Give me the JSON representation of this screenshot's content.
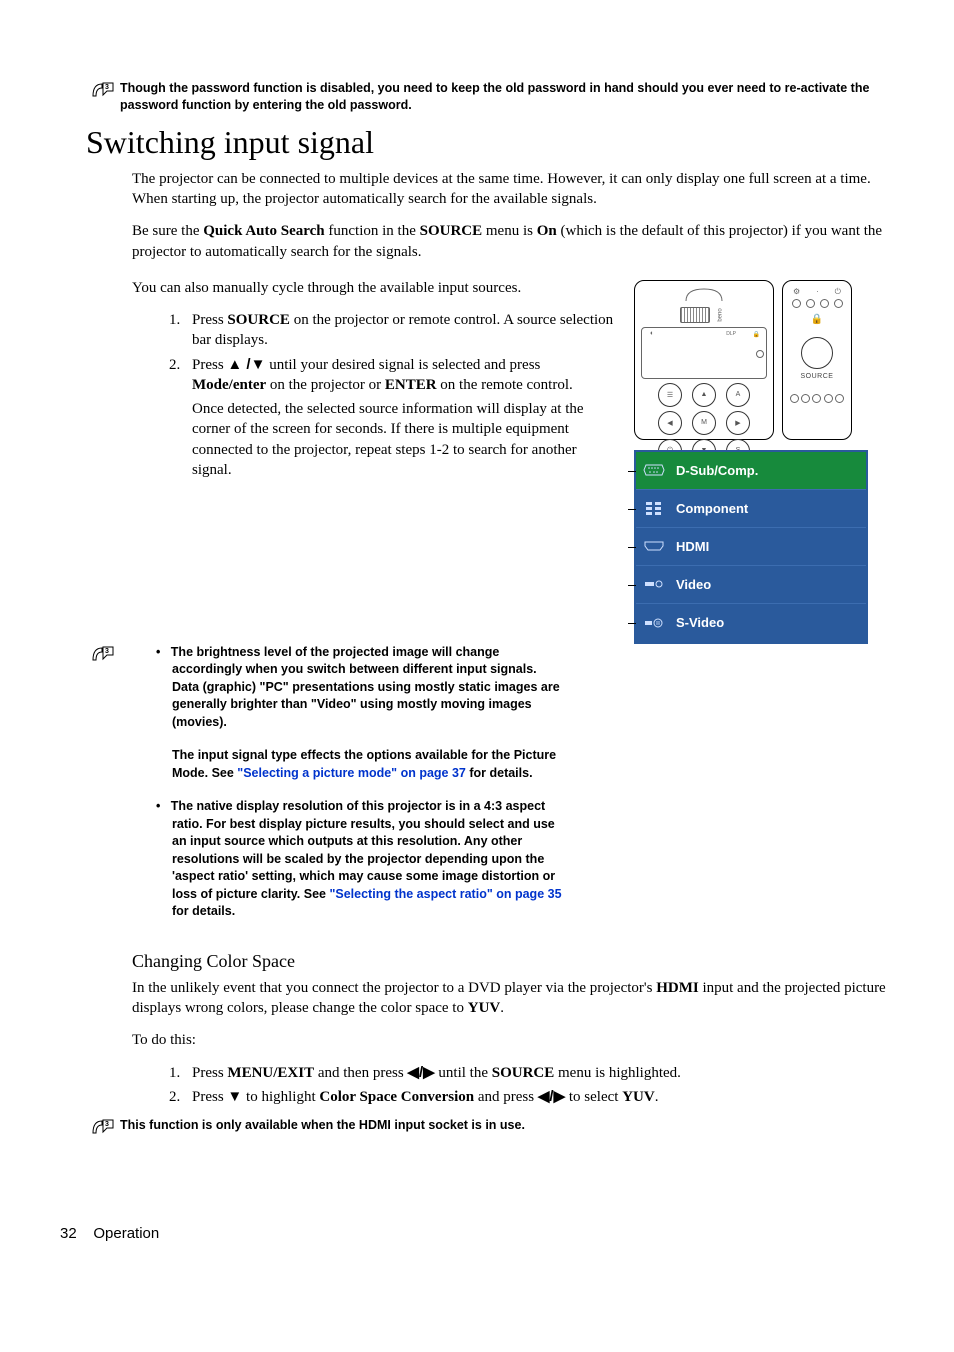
{
  "top_note": "Though the password function is disabled, you need to keep the old password in hand should you ever need to re-activate the password function by entering the old password.",
  "heading": "Switching input signal",
  "para1": "The projector can be connected to multiple devices at the same time. However, it can only display one full screen at a time. When starting up, the projector automatically search for the available signals.",
  "para2_pre": "Be sure the ",
  "para2_qas": "Quick Auto Search",
  "para2_mid1": " function in the ",
  "para2_source": "SOURCE",
  "para2_mid2": " menu is ",
  "para2_on": "On",
  "para2_post": " (which is the default of this projector) if you want the projector to automatically search for the signals.",
  "para3": "You can also manually cycle through the available input sources.",
  "step1_pre": "Press ",
  "step1_src": "SOURCE",
  "step1_post": " on the projector or remote control. A source selection bar displays.",
  "step2_pre": "Press ",
  "step2_mid": " until your desired signal is selected and press ",
  "step2_mode": "Mode/enter",
  "step2_mid2": " on the projector or ",
  "step2_enter": "ENTER",
  "step2_mid3": " on the remote control.",
  "step2_tail": "Once detected, the selected source information will display at the corner of the screen for seconds. If there is multiple equipment connected to the projector, repeat steps 1-2 to search for another signal.",
  "note_a": "The brightness level of the projected image will change accordingly when you switch between different input signals. Data (graphic) \"PC\" presentations using mostly static images are generally brighter than \"Video\" using mostly moving images (movies).",
  "note_b_pre": "The input signal type effects the options available for the Picture Mode. See ",
  "note_b_link": "\"Selecting a picture mode\" on page 37",
  "note_b_post": " for details.",
  "note_c_pre": "The native display resolution of this projector is in a 4:3 aspect ratio. For best display picture results, you should select and use an input source which outputs at this resolution. Any other resolutions will be scaled by the projector depending upon the 'aspect ratio' setting, which may cause some image distortion or loss of picture clarity. See ",
  "note_c_link": "\"Selecting the aspect ratio\" on page 35",
  "note_c_post": " for details.",
  "subhead": "Changing Color Space",
  "ccs_para_pre": "In the unlikely event that you connect the projector to a DVD player via the projector's ",
  "ccs_hdmi": "HDMI",
  "ccs_para_mid": " input and the projected picture displays wrong colors, please change the color space to ",
  "ccs_yuv": "YUV",
  "ccs_para_post": ".",
  "todo": "To do this:",
  "ccs_step1_pre": "Press ",
  "ccs_step1_menu": "MENU/EXIT",
  "ccs_step1_mid": " and then press ",
  "ccs_step1_mid2": " until the ",
  "ccs_step1_src": "SOURCE",
  "ccs_step1_post": " menu is highlighted.",
  "ccs_step2_pre": "Press ",
  "ccs_step2_mid": " to highlight ",
  "ccs_step2_csc": "Color Space Conversion",
  "ccs_step2_mid2": " and press ",
  "ccs_step2_mid3": " to select ",
  "ccs_step2_yuv": "YUV",
  "ccs_step2_post": ".",
  "bottom_note": "This function is only available when the HDMI input socket is in use.",
  "remote_source_label": "SOURCE",
  "panel_dlp_label": "DLP",
  "source_menu": {
    "items": [
      {
        "label": "D-Sub/Comp.",
        "selected": true
      },
      {
        "label": "Component",
        "selected": false
      },
      {
        "label": "HDMI",
        "selected": false
      },
      {
        "label": "Video",
        "selected": false
      },
      {
        "label": "S-Video",
        "selected": false
      }
    ]
  },
  "footer_page": "32",
  "footer_section": "Operation"
}
